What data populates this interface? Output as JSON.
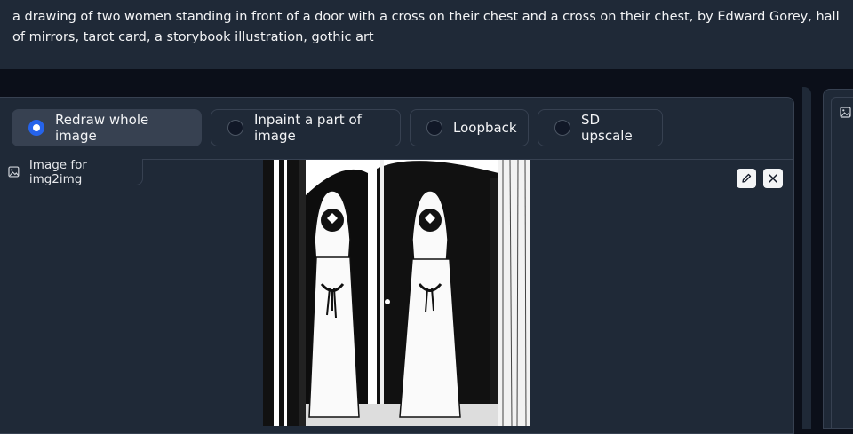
{
  "prompt": {
    "text": "a drawing of two women standing in front of a door with a cross on their chest and a cross on their chest, by Edward Gorey, hall of mirrors, tarot card, a storybook illustration, gothic art"
  },
  "mode_options": [
    {
      "label": "Redraw whole image",
      "selected": true
    },
    {
      "label": "Inpaint a part of image",
      "selected": false
    },
    {
      "label": "Loopback",
      "selected": false
    },
    {
      "label": "SD upscale",
      "selected": false
    }
  ],
  "image_panel": {
    "label": "Image for img2img",
    "label_icon": "image-icon",
    "tools": [
      "edit-icon",
      "close-icon"
    ]
  },
  "colors": {
    "accent": "#2563eb",
    "panel": "#1f2937",
    "background": "#0b0f19",
    "border": "#374151"
  }
}
